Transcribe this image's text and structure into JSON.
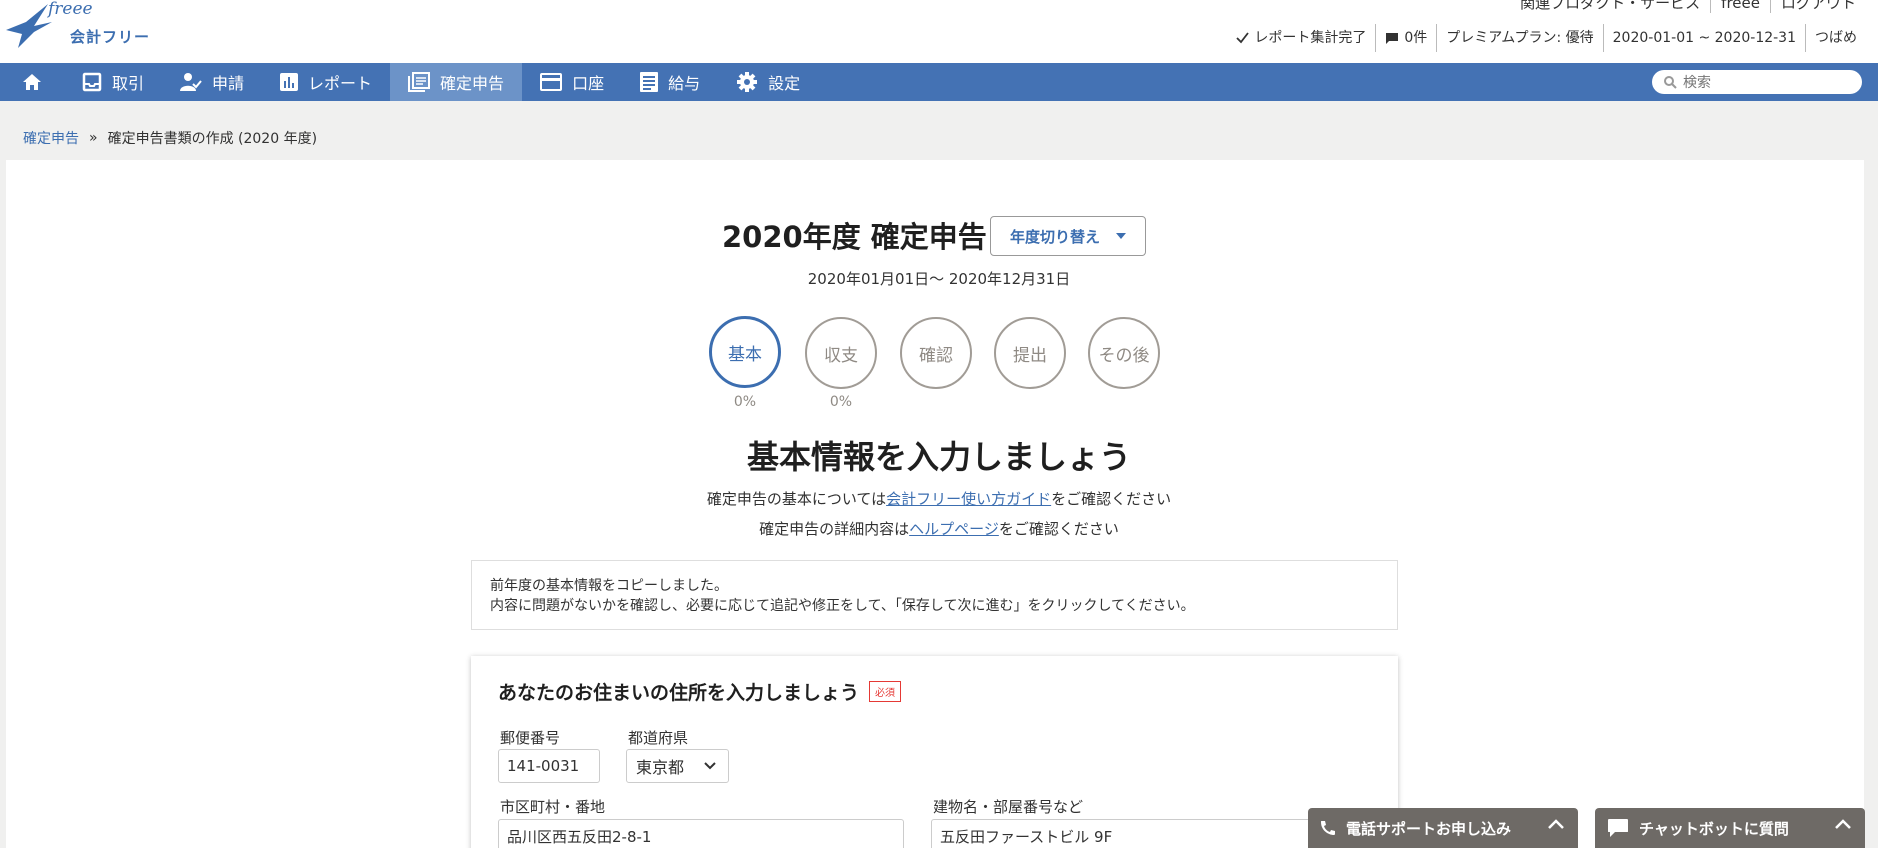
{
  "header": {
    "logo_word": "freee",
    "logo_name": "会計フリー",
    "top_links": [
      "関連プロダクト・サービス",
      "freee",
      "ログアウト"
    ],
    "status": {
      "report": "レポート集計完了",
      "messages": "0件",
      "plan": "プレミアムプラン: 優待",
      "period": "2020-01-01 ~ 2020-12-31",
      "user": "つばめ"
    }
  },
  "nav": {
    "items": [
      {
        "label": "取引",
        "icon": "inbox-icon"
      },
      {
        "label": "申請",
        "icon": "user-check-icon"
      },
      {
        "label": "レポート",
        "icon": "bar-chart-icon"
      },
      {
        "label": "確定申告",
        "icon": "document-stack-icon"
      },
      {
        "label": "口座",
        "icon": "credit-card-icon"
      },
      {
        "label": "給与",
        "icon": "list-document-icon"
      },
      {
        "label": "設定",
        "icon": "gear-icon"
      }
    ],
    "search_placeholder": "検索",
    "colors": {
      "bar": "#4472b4",
      "active": "#6c93c8"
    }
  },
  "breadcrumb": {
    "link": "確定申告",
    "separator": "»",
    "current": "確定申告書類の作成 (2020 年度)"
  },
  "main": {
    "title": "2020年度 確定申告",
    "year_switch": "年度切り替え",
    "period": "2020年01月01日～ 2020年12月31日",
    "steps": [
      {
        "label": "基本",
        "pct": "0%"
      },
      {
        "label": "収支",
        "pct": "0%"
      },
      {
        "label": "確認"
      },
      {
        "label": "提出"
      },
      {
        "label": "その後"
      }
    ],
    "section_title": "基本情報を入力しましょう",
    "guide1_pre": "確定申告の基本については",
    "guide1_link": "会計フリー使い方ガイド",
    "guide1_post": "をご確認ください",
    "guide2_pre": "確定申告の詳細内容は",
    "guide2_link": "ヘルプページ",
    "guide2_post": "をご確認ください",
    "notice_line1": "前年度の基本情報をコピーしました。",
    "notice_line2": "内容に問題がないかを確認し、必要に応じて追記や修正をして、「保存して次に進む」をクリックしてください。"
  },
  "address_card": {
    "title": "あなたのお住まいの住所を入力しましょう",
    "required": "必須",
    "postal_label": "郵便番号",
    "postal_value": "141-0031",
    "pref_label": "都道府県",
    "pref_value": "東京都",
    "city_label": "市区町村・番地",
    "city_value": "品川区西五反田2-8-1",
    "building_label": "建物名・部屋番号など",
    "building_value": "五反田ファーストビル 9F"
  },
  "floating": {
    "phone": "電話サポートお申し込み",
    "chat": "チャットボットに質問"
  }
}
